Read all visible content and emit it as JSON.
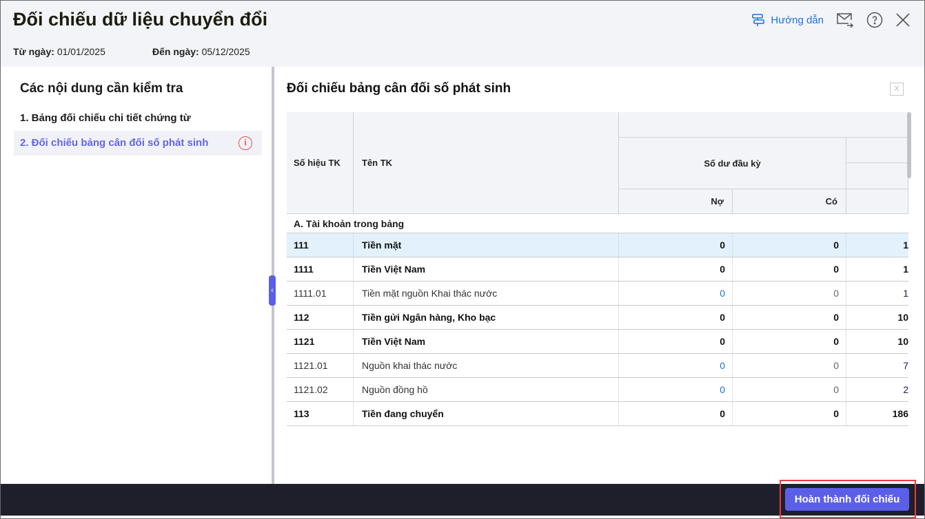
{
  "header": {
    "title": "Đối chiếu dữ liệu chuyển đổi",
    "from_label": "Từ ngày:",
    "from_value": "01/01/2025",
    "to_label": "Đến ngày:",
    "to_value": "05/12/2025",
    "guide_label": "Hướng dẫn"
  },
  "left": {
    "title": "Các nội dung cần kiểm tra",
    "items": [
      {
        "label": "1. Bảng đối chiếu chi tiết chứng từ"
      },
      {
        "label": "2. Đối chiếu bảng cân đối số phát sinh"
      }
    ]
  },
  "main": {
    "title": "Đối chiếu bảng cân đối số phát sinh",
    "columns": {
      "code": "Số hiệu TK",
      "name": "Tên TK",
      "opening": "Số dư đầu kỳ",
      "debit": "Nợ",
      "credit": "Có"
    },
    "group": "A. Tài khoản trong bảng",
    "rows": [
      {
        "code": "111",
        "name": "Tiền mặt",
        "debit": "0",
        "credit": "0",
        "next": "1",
        "bold": true
      },
      {
        "code": "1111",
        "name": "Tiền Việt Nam",
        "debit": "0",
        "credit": "0",
        "next": "1",
        "bold": true
      },
      {
        "code": "1111.01",
        "name": "Tiền mặt nguồn Khai thác nước",
        "debit": "0",
        "credit": "0",
        "next": "1",
        "bold": false
      },
      {
        "code": "112",
        "name": "Tiền gửi Ngân hàng, Kho bạc",
        "debit": "0",
        "credit": "0",
        "next": "10",
        "bold": true
      },
      {
        "code": "1121",
        "name": "Tiền Việt Nam",
        "debit": "0",
        "credit": "0",
        "next": "10",
        "bold": true
      },
      {
        "code": "1121.01",
        "name": "Nguồn khai thác nước",
        "debit": "0",
        "credit": "0",
        "next": "7",
        "bold": false
      },
      {
        "code": "1121.02",
        "name": "Nguồn đồng hồ",
        "debit": "0",
        "credit": "0",
        "next": "2",
        "bold": false
      },
      {
        "code": "113",
        "name": "Tiền đang chuyển",
        "debit": "0",
        "credit": "0",
        "next": "186",
        "bold": true
      }
    ]
  },
  "footer": {
    "done_label": "Hoàn thành đối chiếu"
  },
  "colors": {
    "accent": "#5b5fe8",
    "link": "#1a73d9",
    "warning": "#ef4b55",
    "footer": "#1e1f2b"
  }
}
